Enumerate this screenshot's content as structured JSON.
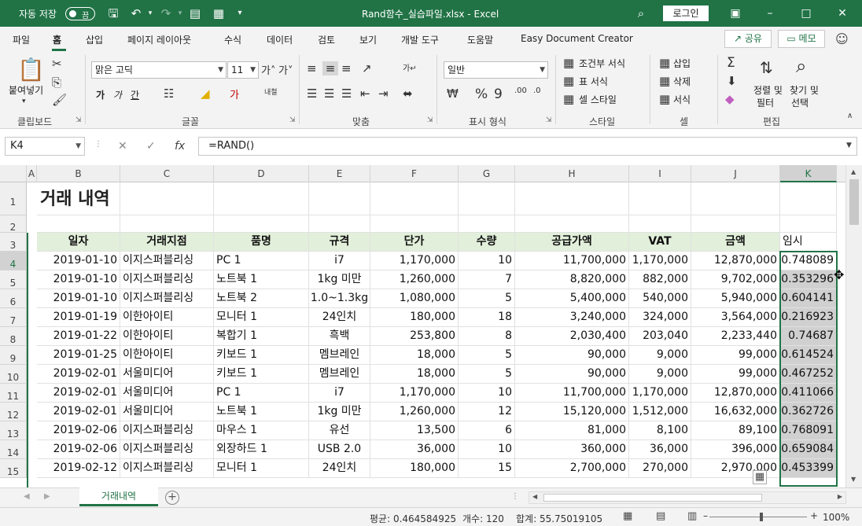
{
  "titlebar": {
    "autosave_label": "자동 저장",
    "autosave_state": "끔",
    "doc_title": "Rand함수_실습파일.xlsx  -  Excel",
    "login_label": "로그인"
  },
  "tabs": [
    "파일",
    "홈",
    "삽입",
    "페이지 레이아웃",
    "수식",
    "데이터",
    "검토",
    "보기",
    "개발 도구",
    "도움말",
    "Easy Document Creator"
  ],
  "share_label": "공유",
  "memo_label": "메모",
  "ribbon": {
    "clipboard": {
      "paste": "붙여넣기",
      "label": "클립보드"
    },
    "font": {
      "name": "맑은 고딕",
      "size": "11",
      "label": "글꼴",
      "bold": "가",
      "italic": "가",
      "underline": "간"
    },
    "align": {
      "label": "맞춤"
    },
    "number": {
      "format": "일반",
      "label": "표시 형식"
    },
    "styles": {
      "conditional": "조건부 서식",
      "table": "표 서식",
      "cell": "셀 스타일",
      "label": "스타일"
    },
    "cells": {
      "insert": "삽입",
      "delete": "삭제",
      "format": "서식",
      "label": "셀"
    },
    "editing": {
      "sortfilter1": "정렬 및",
      "sortfilter2": "필터",
      "find1": "찾기 및",
      "find2": "선택",
      "label": "편집"
    }
  },
  "namebox": "K4",
  "formula": "=RAND()",
  "columns": [
    "A",
    "B",
    "C",
    "D",
    "E",
    "F",
    "G",
    "H",
    "I",
    "J",
    "K"
  ],
  "sheet_title": "거래 내역",
  "headers": [
    "일자",
    "거래지점",
    "품명",
    "규격",
    "단가",
    "수량",
    "공급가액",
    "VAT",
    "금액",
    "임시"
  ],
  "rows": [
    [
      "2019-01-10",
      "이지스퍼블리싱",
      "PC 1",
      "i7",
      "1,170,000",
      "10",
      "11,700,000",
      "1,170,000",
      "12,870,000",
      "0.748089"
    ],
    [
      "2019-01-10",
      "이지스퍼블리싱",
      "노트북 1",
      "1kg 미만",
      "1,260,000",
      "7",
      "8,820,000",
      "882,000",
      "9,702,000",
      "0.353296"
    ],
    [
      "2019-01-10",
      "이지스퍼블리싱",
      "노트북 2",
      "1.0~1.3kg",
      "1,080,000",
      "5",
      "5,400,000",
      "540,000",
      "5,940,000",
      "0.604141"
    ],
    [
      "2019-01-19",
      "이한아이티",
      "모니터 1",
      "24인치",
      "180,000",
      "18",
      "3,240,000",
      "324,000",
      "3,564,000",
      "0.216923"
    ],
    [
      "2019-01-22",
      "이한아이티",
      "복합기 1",
      "흑백",
      "253,800",
      "8",
      "2,030,400",
      "203,040",
      "2,233,440",
      "0.74687"
    ],
    [
      "2019-01-25",
      "이한아이티",
      "키보드 1",
      "멤브레인",
      "18,000",
      "5",
      "90,000",
      "9,000",
      "99,000",
      "0.614524"
    ],
    [
      "2019-02-01",
      "서울미디어",
      "키보드 1",
      "멤브레인",
      "18,000",
      "5",
      "90,000",
      "9,000",
      "99,000",
      "0.467252"
    ],
    [
      "2019-02-01",
      "서울미디어",
      "PC 1",
      "i7",
      "1,170,000",
      "10",
      "11,700,000",
      "1,170,000",
      "12,870,000",
      "0.411066"
    ],
    [
      "2019-02-01",
      "서울미디어",
      "노트북 1",
      "1kg 미만",
      "1,260,000",
      "12",
      "15,120,000",
      "1,512,000",
      "16,632,000",
      "0.362726"
    ],
    [
      "2019-02-06",
      "이지스퍼블리싱",
      "마우스 1",
      "유선",
      "13,500",
      "6",
      "81,000",
      "8,100",
      "89,100",
      "0.768091"
    ],
    [
      "2019-02-06",
      "이지스퍼블리싱",
      "외장하드 1",
      "USB 2.0",
      "36,000",
      "10",
      "360,000",
      "36,000",
      "396,000",
      "0.659084"
    ],
    [
      "2019-02-12",
      "이지스퍼블리싱",
      "모니터 1",
      "24인치",
      "180,000",
      "15",
      "2,700,000",
      "270,000",
      "2,970,000",
      "0.453399"
    ]
  ],
  "row_numbers": [
    "1",
    "2",
    "3",
    "4",
    "5",
    "6",
    "7",
    "8",
    "9",
    "10",
    "11",
    "12",
    "13",
    "14",
    "15"
  ],
  "sheet_tab": "거래내역",
  "status": {
    "average": "평균: 0.464584925",
    "count": "개수: 120",
    "sum": "합계: 55.75019105",
    "zoom": "100%"
  },
  "colors": {
    "accent": "#217346",
    "header_fill": "#e2efda"
  }
}
